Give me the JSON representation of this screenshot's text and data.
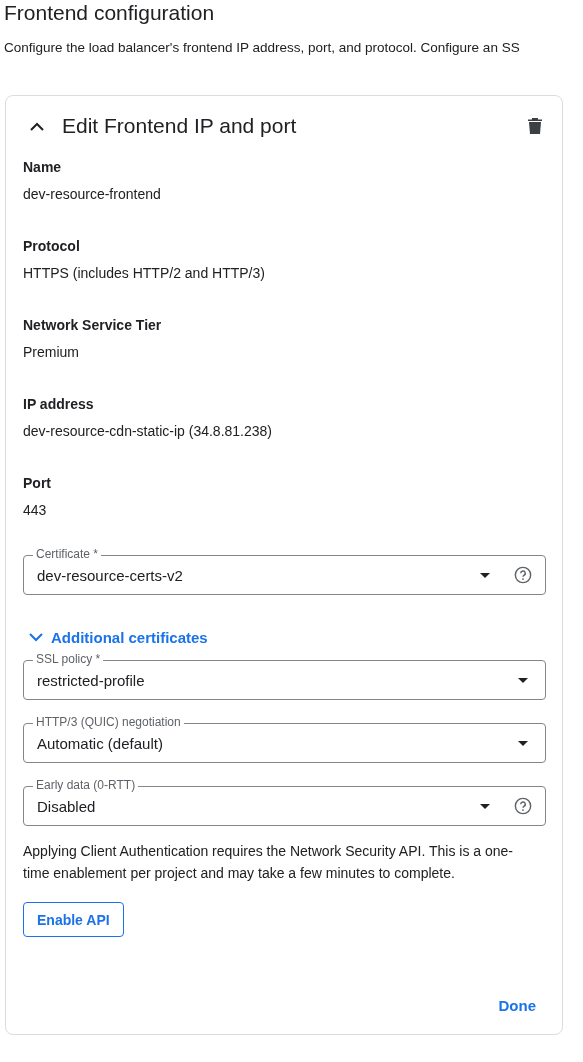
{
  "page": {
    "title": "Frontend configuration",
    "description": "Configure the load balancer's frontend IP address, port, and protocol. Configure an SS"
  },
  "card": {
    "expanded": true,
    "title": "Edit Frontend IP and port",
    "properties": [
      {
        "label": "Name",
        "value": "dev-resource-frontend"
      },
      {
        "label": "Protocol",
        "value": "HTTPS (includes HTTP/2 and HTTP/3)"
      },
      {
        "label": "Network Service Tier",
        "value": "Premium"
      },
      {
        "label": "IP address",
        "value": "dev-resource-cdn-static-ip (34.8.81.238)"
      },
      {
        "label": "Port",
        "value": "443"
      }
    ],
    "certificate": {
      "label": "Certificate *",
      "value": "dev-resource-certs-v2",
      "help": true
    },
    "additional_certificates": {
      "label": "Additional certificates",
      "expanded": false
    },
    "selects": [
      {
        "label": "SSL policy *",
        "value": "restricted-profile",
        "help": false
      },
      {
        "label": "HTTP/3 (QUIC) negotiation",
        "value": "Automatic (default)",
        "help": false
      },
      {
        "label": "Early data (0-RTT)",
        "value": "Disabled",
        "help": true
      }
    ],
    "notice": "Applying Client Authentication requires the Network Security API. This is a one-time enablement per project and may take a few minutes to complete.",
    "enable_button": "Enable API",
    "done_button": "Done"
  }
}
